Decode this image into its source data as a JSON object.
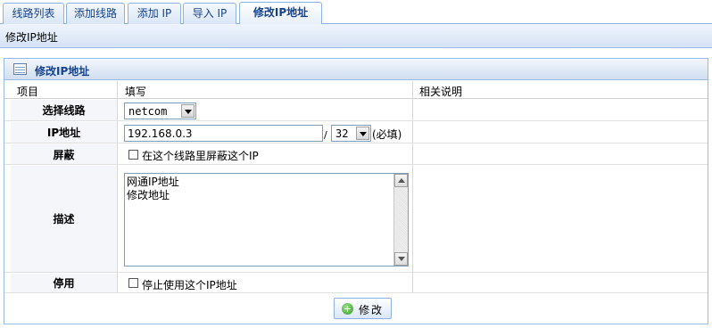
{
  "tabs": [
    {
      "label": "线路列表"
    },
    {
      "label": "添加线路"
    },
    {
      "label": "添加 IP"
    },
    {
      "label": "导入 IP"
    },
    {
      "label": "修改IP地址",
      "active": true
    }
  ],
  "page_title": "修改IP地址",
  "panel": {
    "title": "修改IP地址",
    "columns": [
      "项目",
      "填写",
      "相关说明"
    ],
    "rows": {
      "line": {
        "label": "选择线路",
        "value": "netcom"
      },
      "ip": {
        "label": "IP地址",
        "value": "192.168.0.3",
        "separator": "/",
        "mask": "32",
        "required": "(必填)"
      },
      "shield": {
        "label": "屏蔽",
        "checkbox_label": "在这个线路里屏蔽这个IP"
      },
      "desc": {
        "label": "描述",
        "lines": [
          "网通IP地址",
          "修改地址"
        ]
      },
      "disable": {
        "label": "停用",
        "checkbox_label": "停止使用这个IP地址"
      }
    },
    "submit_label": "修改"
  },
  "colors": {
    "accent": "#15428b",
    "border": "#99bbe8",
    "label_bg": "#f4f6f9"
  }
}
